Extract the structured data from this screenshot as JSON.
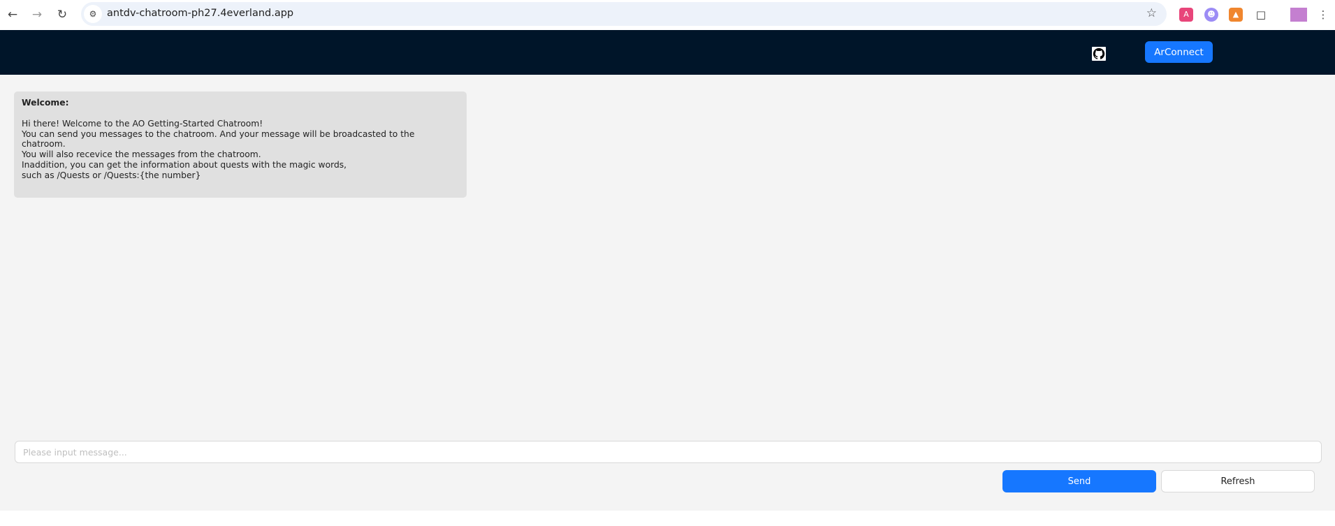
{
  "browser": {
    "url": "antdv-chatroom-ph27.4everland.app",
    "icons": [
      "back-icon",
      "forward-icon",
      "reload-icon",
      "site-info-icon",
      "bookmark-star-icon",
      "translate-extension-icon",
      "extension-icon",
      "metamask-fox-icon",
      "extensions-puzzle-icon",
      "profile-avatar",
      "menu-icon"
    ]
  },
  "header": {
    "github_icon": "github-icon",
    "connect_label": "ArConnect",
    "accent": "#1677ff",
    "background": "#001529"
  },
  "messages": [
    {
      "title": "Welcome:",
      "lines": [
        "Hi there! Welcome to the AO Getting-Started Chatroom!",
        "You can send you messages to the chatroom. And your message will be broadcasted to the chatroom.",
        "You will also recevice the messages from the chatroom.",
        "Inaddition, you can get the information about quests with the magic words,",
        "such as /Quests or /Quests:{the number}"
      ]
    }
  ],
  "composer": {
    "value": "",
    "placeholder": "Please input message...",
    "send_label": "Send",
    "refresh_label": "Refresh"
  }
}
